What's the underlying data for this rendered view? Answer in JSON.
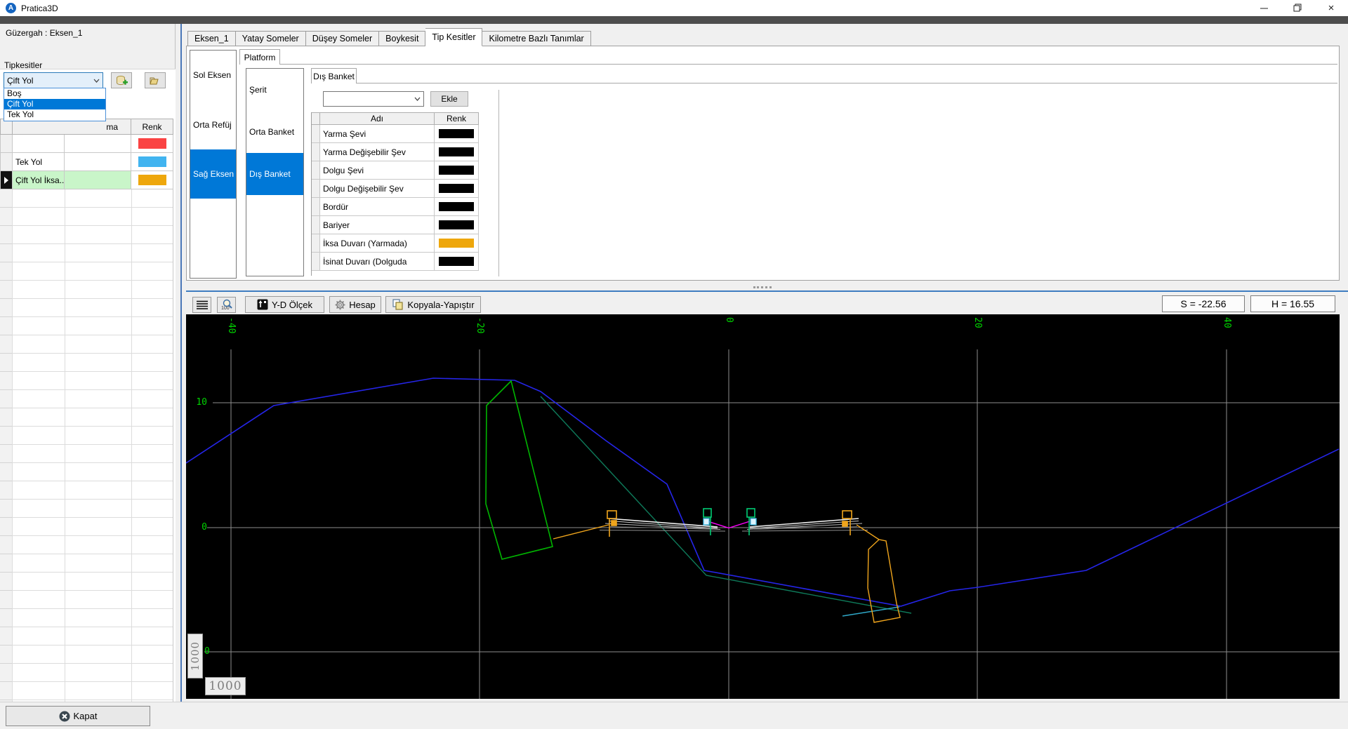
{
  "window": {
    "title": "Pratica3D"
  },
  "sidebar": {
    "route_label": "Güzergah : Eksen_1",
    "section_label": "Tipkesitler",
    "combo": {
      "value": "Çift Yol",
      "options": [
        "Boş",
        "Çift Yol",
        "Tek Yol"
      ],
      "highlighted": "Çift Yol"
    },
    "table": {
      "header_partial": "ma",
      "header_renk": "Renk",
      "rows": [
        {
          "name": "",
          "color": "#fa4343"
        },
        {
          "name": "Tek Yol",
          "color": "#41b4f0"
        },
        {
          "name": "Çift Yol İksa...",
          "color": "#eea70c"
        }
      ]
    }
  },
  "tabs": {
    "items": [
      "Eksen_1",
      "Yatay Someler",
      "Düşey Someler",
      "Boykesit",
      "Tip Kesitler",
      "Kilometre Bazlı Tanımlar"
    ],
    "active": "Tip Kesitler"
  },
  "platform": {
    "tab": "Platform",
    "axes": [
      "Sol Eksen",
      "Orta Refüj",
      "Sağ Eksen"
    ],
    "axis_selected": "Sağ Eksen",
    "sections": [
      "Şerit",
      "Orta Banket",
      "Dış Banket"
    ],
    "section_selected": "Dış Banket"
  },
  "dis_banket": {
    "tab": "Dış Banket",
    "combo_value": "",
    "add_button": "Ekle",
    "headers": {
      "name": "Adı",
      "color": "Renk"
    },
    "rows": [
      {
        "name": "Yarma Şevi",
        "color": "#000000"
      },
      {
        "name": "Yarma Değişebilir Şev",
        "color": "#000000"
      },
      {
        "name": "Dolgu Şevi",
        "color": "#000000"
      },
      {
        "name": "Dolgu Değişebilir Şev",
        "color": "#000000"
      },
      {
        "name": "Bordür",
        "color": "#000000"
      },
      {
        "name": "Bariyer",
        "color": "#000000"
      },
      {
        "name": "İksa Duvarı (Yarmada)",
        "color": "#eea70c"
      },
      {
        "name": "İsinat Duvarı (Dolguda",
        "color": "#000000"
      }
    ]
  },
  "toolbar": {
    "yd_button": "Y-D Ölçek",
    "hesap_button": "Hesap",
    "copy_button": "Kopyala-Yapıştır",
    "s_readout": "S = -22.56",
    "h_readout": "H = 16.55"
  },
  "canvas": {
    "top_ticks": [
      "-40",
      "-20",
      "0",
      "20",
      "40"
    ],
    "left_ticks": [
      "10",
      "0"
    ],
    "bottom_partial_tick": "0",
    "scale_vertical": "1000",
    "scale_horizontal": "1000",
    "colors": {
      "label": "#00d300",
      "grid": "#8e8e8e",
      "terrain": "#2525e8",
      "design_teal": "#0e7a5a",
      "design_cyan": "#2fa8c8",
      "polygon": "#00b400",
      "wall": "#f0a51c",
      "median": "#ff00ff",
      "marker_green": "#00cc74",
      "marker_cyan": "#45c2ec"
    }
  },
  "footer": {
    "close_button": "Kapat"
  }
}
